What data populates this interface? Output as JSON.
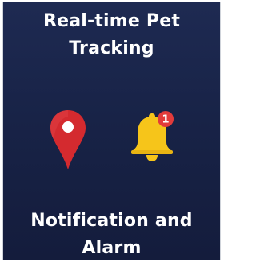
{
  "header": {
    "line1": "Real-time Pet",
    "line2": "Tracking"
  },
  "icons": {
    "location": "map-pin-icon",
    "notification": "bell-icon",
    "notification_badge_count": "1"
  },
  "footer": {
    "line1": "Notification and",
    "line2": "Alarm"
  },
  "colors": {
    "background": "#1a2448",
    "pin": "#d42a2f",
    "bell": "#f6c51a",
    "badge": "#e23b3b",
    "text": "#ffffff"
  }
}
